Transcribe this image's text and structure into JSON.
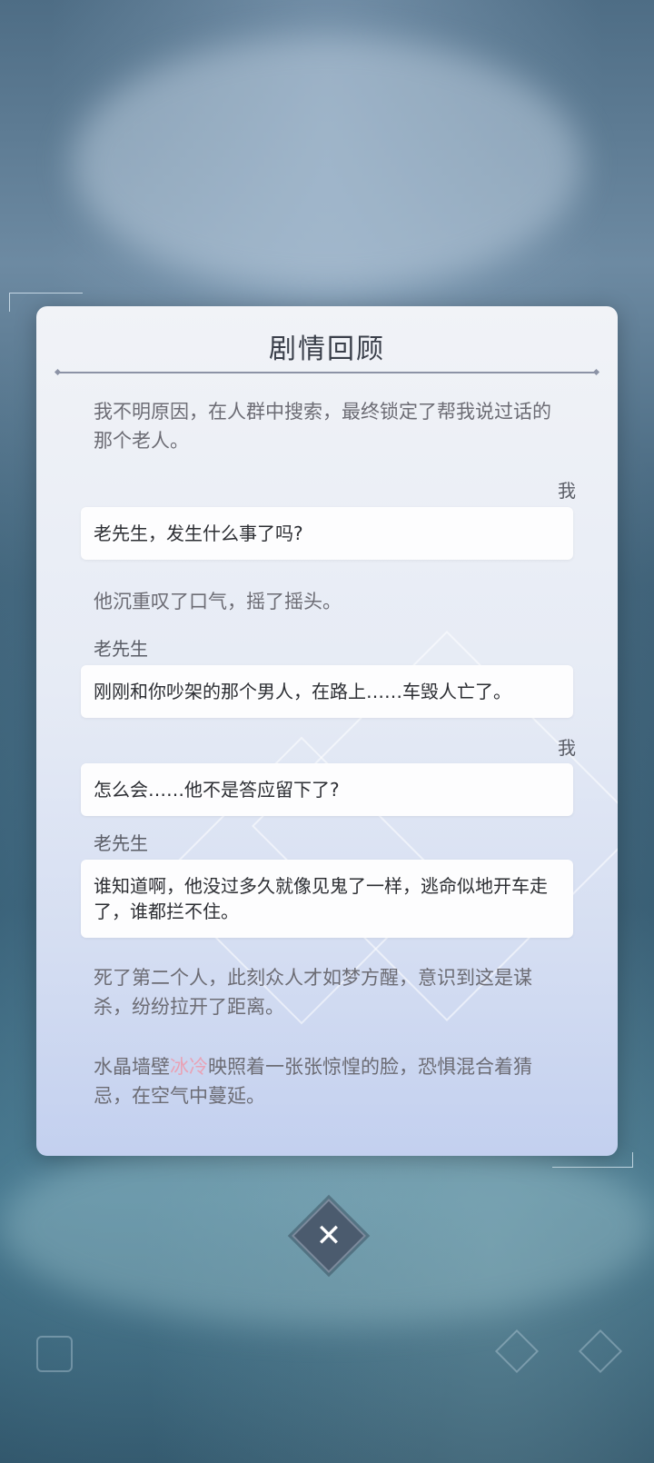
{
  "panel": {
    "title": "剧情回顾",
    "entries": [
      {
        "type": "narration",
        "text": "我不明原因，在人群中搜索，最终锁定了帮我说过话的那个老人。"
      },
      {
        "type": "dialogue",
        "speaker": "我",
        "side": "right",
        "text": "老先生，发生什么事了吗?"
      },
      {
        "type": "narration",
        "text": "他沉重叹了口气，摇了摇头。"
      },
      {
        "type": "dialogue",
        "speaker": "老先生",
        "side": "left",
        "text": "刚刚和你吵架的那个男人，在路上……车毁人亡了。"
      },
      {
        "type": "dialogue",
        "speaker": "我",
        "side": "right",
        "text": "怎么会……他不是答应留下了?"
      },
      {
        "type": "dialogue",
        "speaker": "老先生",
        "side": "left",
        "text": "谁知道啊，他没过多久就像见鬼了一样，逃命似地开车走了，谁都拦不住。"
      },
      {
        "type": "narration",
        "text": "死了第二个人，此刻众人才如梦方醒，意识到这是谋杀，纷纷拉开了距离。"
      },
      {
        "type": "narration_highlight",
        "before": "水晶墙壁",
        "highlight": "冰冷",
        "after": "映照着一张张惊惶的脸，恐惧混合着猜忌，在空气中蔓延。"
      }
    ]
  },
  "close_button": {
    "icon": "close-icon",
    "glyph": "✕"
  },
  "colors": {
    "highlight": "#e9a2b5",
    "panel_top": "#f1f3f7",
    "panel_bottom": "#c3d0ef"
  }
}
